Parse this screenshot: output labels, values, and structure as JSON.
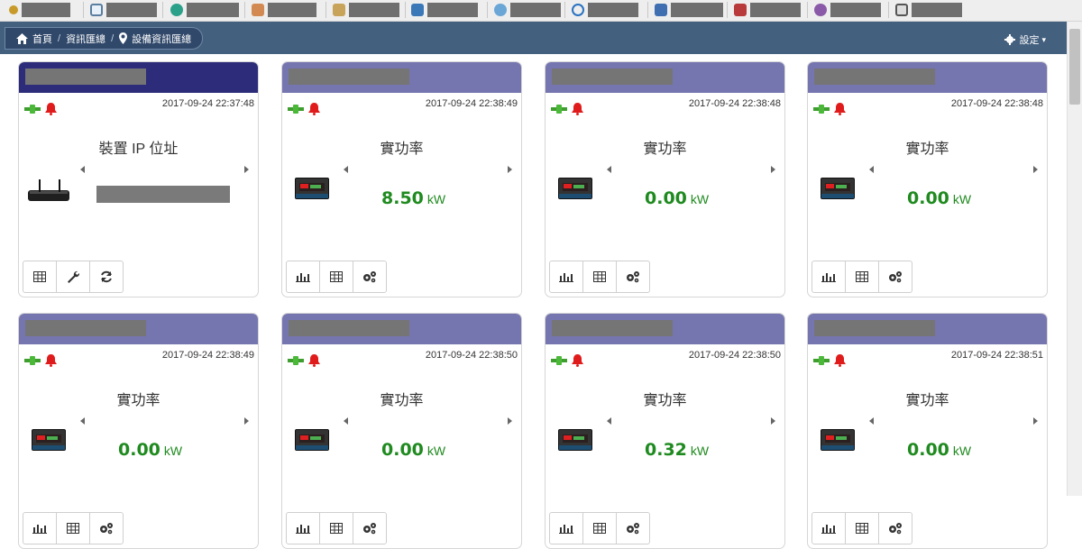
{
  "navbar": {
    "breadcrumb": [
      {
        "icon": "home-icon",
        "label": "首頁"
      },
      {
        "label": "資訊匯總"
      },
      {
        "icon": "map-marker-icon",
        "label": "設備資訊匯總"
      }
    ],
    "settings_label": "設定"
  },
  "toolbar_icons": [
    "search-icon",
    "monitor-icon",
    "circle-icon",
    "chart-icon",
    "clipboard-icon",
    "card-icon",
    "disk-icon",
    "link-icon",
    "calendar-icon",
    "switch-icon",
    "star-icon",
    "screen-icon"
  ],
  "cards": [
    {
      "timestamp": "2017-09-24 22:37:48",
      "label": "裝置 IP 位址",
      "kind": "device"
    },
    {
      "timestamp": "2017-09-24 22:38:49",
      "label": "實功率",
      "value": "8.50",
      "unit": "kW",
      "kind": "meter"
    },
    {
      "timestamp": "2017-09-24 22:38:48",
      "label": "實功率",
      "value": "0.00",
      "unit": "kW",
      "kind": "meter"
    },
    {
      "timestamp": "2017-09-24 22:38:48",
      "label": "實功率",
      "value": "0.00",
      "unit": "kW",
      "kind": "meter"
    },
    {
      "timestamp": "2017-09-24 22:38:49",
      "label": "實功率",
      "value": "0.00",
      "unit": "kW",
      "kind": "meter"
    },
    {
      "timestamp": "2017-09-24 22:38:50",
      "label": "實功率",
      "value": "0.00",
      "unit": "kW",
      "kind": "meter"
    },
    {
      "timestamp": "2017-09-24 22:38:50",
      "label": "實功率",
      "value": "0.32",
      "unit": "kW",
      "kind": "meter"
    },
    {
      "timestamp": "2017-09-24 22:38:51",
      "label": "實功率",
      "value": "0.00",
      "unit": "kW",
      "kind": "meter"
    }
  ],
  "colors": {
    "header": "#7575b0",
    "header_active": "#2c2c7a",
    "value_green": "#1f8a1f",
    "navbar": "#44607f"
  }
}
